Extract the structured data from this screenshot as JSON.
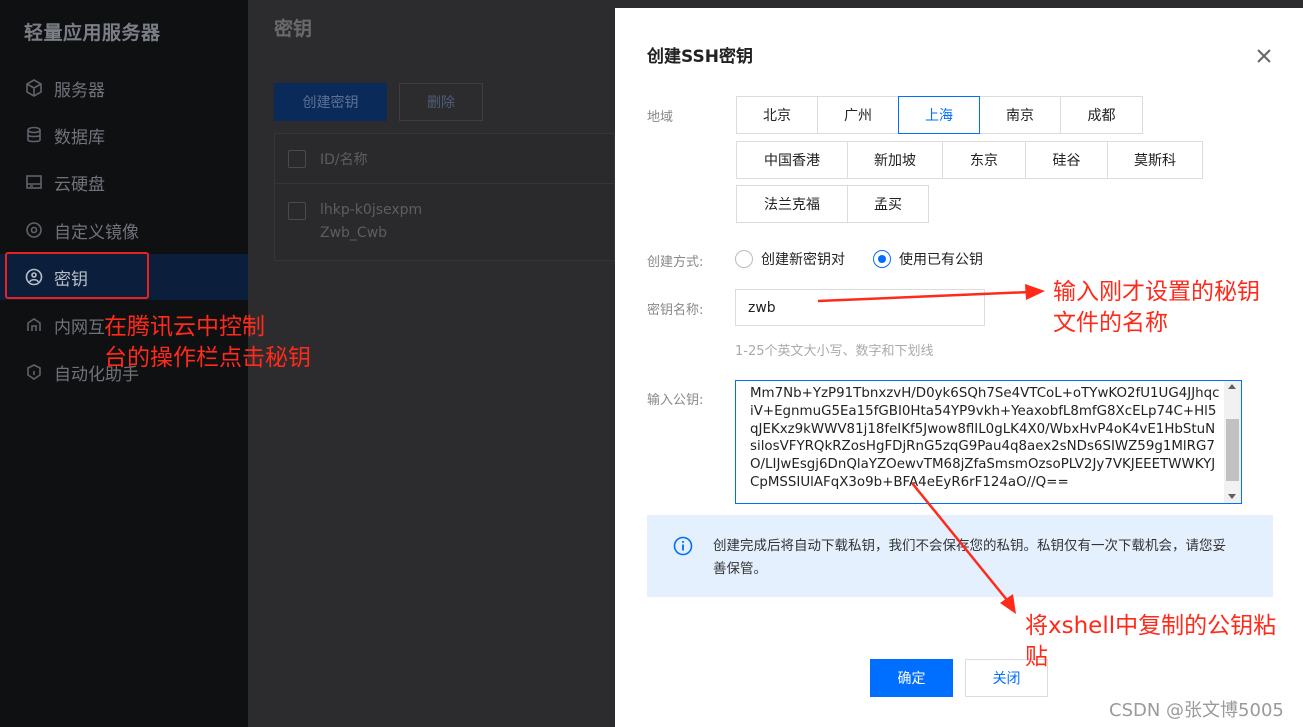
{
  "sidebar": {
    "brand": "轻量应用服务器",
    "items": [
      {
        "label": "服务器",
        "icon": "cube-icon"
      },
      {
        "label": "数据库",
        "icon": "database-icon"
      },
      {
        "label": "云硬盘",
        "icon": "disk-icon"
      },
      {
        "label": "自定义镜像",
        "icon": "image-icon"
      },
      {
        "label": "密钥",
        "icon": "key-icon",
        "active": true
      },
      {
        "label": "内网互",
        "icon": "network-icon"
      },
      {
        "label": "自动化助手",
        "icon": "automation-icon"
      }
    ]
  },
  "main": {
    "title": "密钥",
    "create_label": "创建密钥",
    "delete_label": "删除",
    "table": {
      "header": "ID/名称",
      "rows": [
        {
          "id": "lhkp-k0jsexpm",
          "name": "Zwb_Cwb"
        }
      ]
    }
  },
  "modal": {
    "title": "创建SSH密钥",
    "region_label": "地域",
    "regions_row1": [
      "北京",
      "广州",
      "上海",
      "南京",
      "成都"
    ],
    "regions_row2": [
      "中国香港",
      "新加坡",
      "东京",
      "硅谷",
      "莫斯科"
    ],
    "regions_row3": [
      "法兰克福",
      "孟买"
    ],
    "selected_region": "上海",
    "method_label": "创建方式:",
    "method_options": [
      "创建新密钥对",
      "使用已有公钥"
    ],
    "selected_method": "使用已有公钥",
    "name_label": "密钥名称:",
    "name_value": "zwb",
    "name_hint": "1-25个英文大小写、数字和下划线",
    "pubkey_label": "输入公钥:",
    "pubkey_value": "Mm7Nb+YzP91TbnxzvH/D0yk6SQh7Se4VTCoL+oTYwKO2fU1UG4JJhqciV+EgnmuG5Ea15fGBI0Hta54YP9vkh+YeaxobfL8mfG8XcELp74C+Hl5qJEKxz9kWWV81j18feIKf5Jwow8flIL0gLK4X0/WbxHvP4oK4vE1HbStuNsilosVFYRQkRZosHgFDjRnG5zqG9Pau4q8aex2sNDs6SIWZ59g1MlRG7O/LIJwEsgj6DnQlaYZOewvTM68jZfaSmsmOzsoPLV2Jy7VKJEEETWWKYJCpMSSIUlAFqX3o9b+BFA4eEyR6rF124aO//Q==",
    "notice": "创建完成后将自动下载私钥，我们不会保存您的私钥。私钥仅有一次下载机会，请您妥善保管。",
    "ok_label": "确定",
    "close_label": "关闭"
  },
  "annotations": {
    "sidebar_note_line1": "在腾讯云中控制",
    "sidebar_note_line2": "台的操作栏点击秘钥",
    "name_note_line1": "输入刚才设置的秘钥",
    "name_note_line2": "文件的名称",
    "pubkey_note_line1": "将xshell中复制的公钥粘",
    "pubkey_note_line2": "贴",
    "color": "#ff2a1a"
  },
  "watermark": "CSDN @张文博5005"
}
